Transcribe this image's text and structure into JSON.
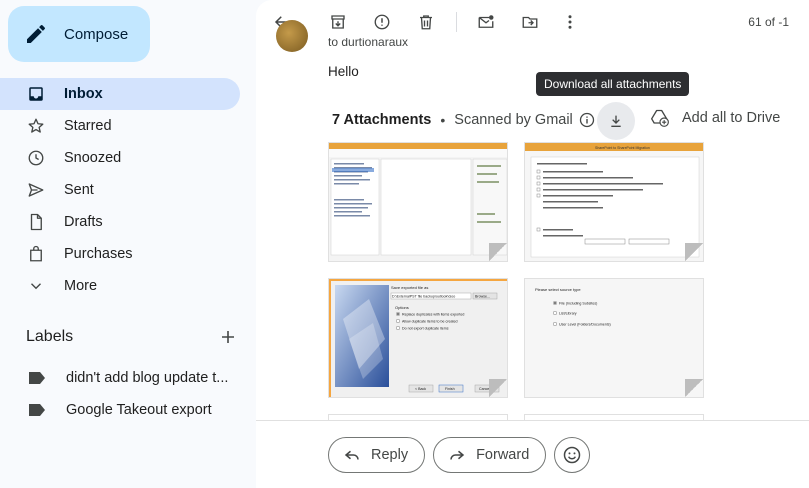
{
  "sidebar": {
    "compose_label": "Compose",
    "items": [
      {
        "label": "Inbox",
        "icon": "inbox-icon",
        "active": true
      },
      {
        "label": "Starred",
        "icon": "star-icon"
      },
      {
        "label": "Snoozed",
        "icon": "clock-icon"
      },
      {
        "label": "Sent",
        "icon": "send-icon"
      },
      {
        "label": "Drafts",
        "icon": "draft-icon"
      },
      {
        "label": "Purchases",
        "icon": "shopping-bag-icon"
      },
      {
        "label": "More",
        "icon": "chevron-down-icon"
      }
    ],
    "labels_title": "Labels",
    "labels": [
      {
        "label": "didn't add blog update t..."
      },
      {
        "label": "Google Takeout export"
      }
    ]
  },
  "toolbar": {
    "page_count": "61 of -1"
  },
  "message": {
    "recipient": "to durtionaraux",
    "body": "Hello"
  },
  "attachments": {
    "count_label": "7 Attachments",
    "separator": "•",
    "scanned_label": "Scanned by Gmail",
    "download_tooltip": "Download all attachments",
    "add_to_drive_label": "Add all to Drive"
  },
  "thumbnails": {
    "t2_title": "SharePoint to SharePoint Migration",
    "t3_line1": "Save exported file as",
    "t3_line2": "D:\\ExternalPST file backup\\outlook\\Goo",
    "t3_browse": "Browse...",
    "t3_options": "Options",
    "t3_opt1": "Replace duplicates with items exported",
    "t3_opt2": "Allow duplicate items to be created",
    "t3_opt3": "Do not export duplicate items",
    "t3_back": "< Back",
    "t3_finish": "Finish",
    "t3_cancel": "Cancel",
    "t4_title": "Please select source type",
    "t4_opt1": "File (Including Subsites)",
    "t4_opt2": "List/Library",
    "t4_opt3": "User Level (Folders/Documents)"
  },
  "actions": {
    "reply_label": "Reply",
    "forward_label": "Forward"
  },
  "colors": {
    "compose_bg": "#c2e7ff",
    "active_nav_bg": "#d3e3fd",
    "thumb_accent": "#e8a33b"
  }
}
